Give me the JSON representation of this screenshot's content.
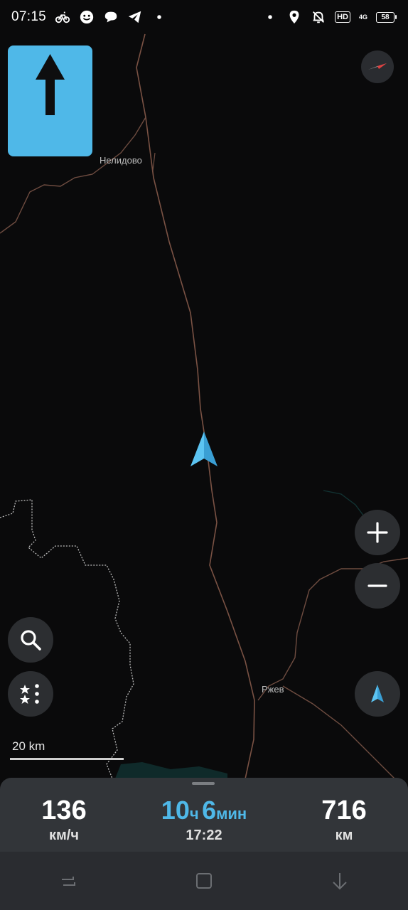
{
  "status_bar": {
    "time": "07:15",
    "left_icons": [
      "bicycle-icon",
      "face-icon",
      "chat-icon",
      "telegram-icon",
      "dot-icon"
    ],
    "right_icons": [
      "dot-icon",
      "location-pin-icon",
      "bell-off-icon"
    ],
    "hd": "HD",
    "network": "4G",
    "battery": "58"
  },
  "navigation": {
    "next_turn_icon": "arrow-up-icon"
  },
  "map": {
    "cities": [
      {
        "name": "Нелидово"
      },
      {
        "name": "Ржев"
      }
    ],
    "scale_label": "20 km",
    "colors": {
      "background": "#0a0a0b",
      "road": "#7a5244",
      "accent": "#4fb8e8"
    }
  },
  "controls": {
    "compass_icon": "compass-icon",
    "zoom_in_icon": "plus-icon",
    "zoom_out_icon": "minus-icon",
    "search_icon": "search-icon",
    "favorites_icon": "favorites-menu-icon",
    "location_icon": "navigation-arrow-icon"
  },
  "trip": {
    "speed": {
      "value": "136",
      "unit": "км/ч"
    },
    "time_remaining": {
      "hours": "10",
      "hours_unit": "ч",
      "minutes": "6",
      "minutes_unit": "мин",
      "arrival": "17:22"
    },
    "distance": {
      "value": "716",
      "unit": "км"
    }
  },
  "system_nav": {
    "keys": [
      "recent-apps-icon",
      "home-icon",
      "back-icon"
    ]
  }
}
